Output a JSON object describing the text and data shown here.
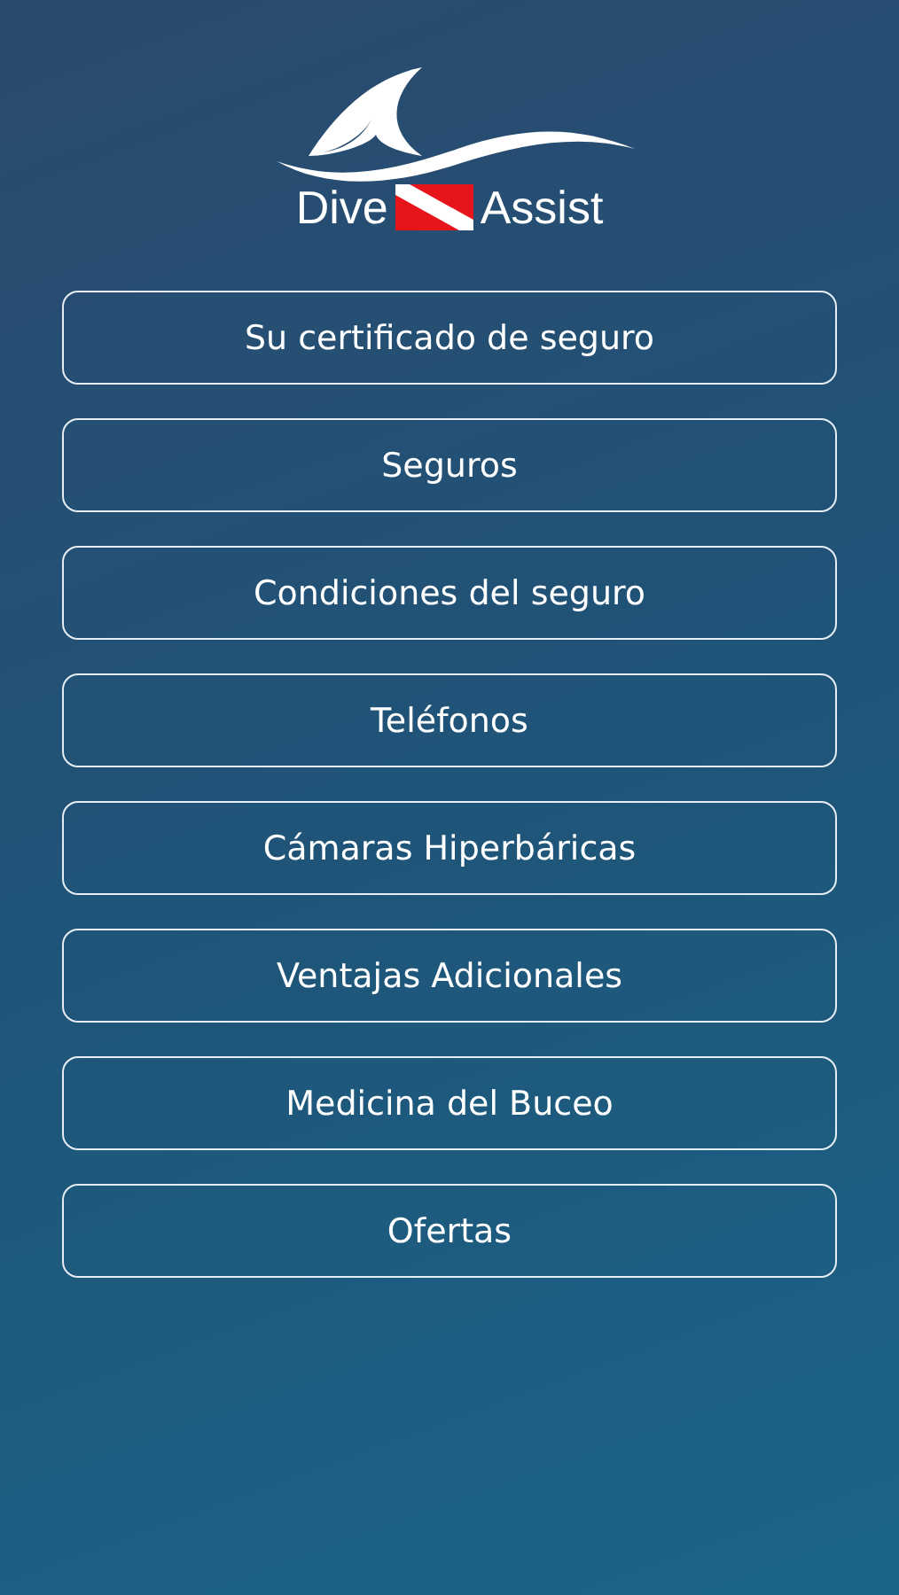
{
  "logo": {
    "word_left": "Dive",
    "word_right": "Assist"
  },
  "menu": [
    {
      "label": "Su certificado de seguro"
    },
    {
      "label": "Seguros"
    },
    {
      "label": "Condiciones del seguro"
    },
    {
      "label": "Teléfonos"
    },
    {
      "label": "Cámaras Hiperbáricas"
    },
    {
      "label": "Ventajas Adicionales"
    },
    {
      "label": "Medicina del Buceo"
    },
    {
      "label": "Ofertas"
    }
  ]
}
